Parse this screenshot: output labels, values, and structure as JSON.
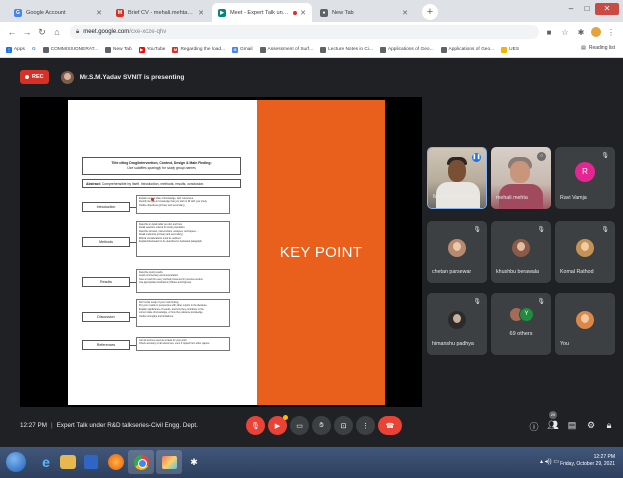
{
  "browser": {
    "tabs": [
      {
        "label": "Google Account",
        "icon": "google-g-icon",
        "active": false
      },
      {
        "label": "Brief CV - mehali.mehta@svnit.ac.in",
        "icon": "gmail-icon",
        "active": false
      },
      {
        "label": "Meet - Expert Talk under R&",
        "icon": "meet-icon",
        "active": true
      },
      {
        "label": "New Tab",
        "icon": "chrome-icon",
        "active": false
      }
    ],
    "address": {
      "host": "meet.google.com",
      "path": "/cxe-xcze-qhv"
    },
    "bookmarks": [
      {
        "label": "Apps",
        "icon": "apps-grid-icon",
        "color": "#1a73e8"
      },
      {
        "label": "G",
        "icon": "google-g-icon",
        "color": "#4285f4"
      },
      {
        "label": "COMMISSIONERAT...",
        "icon": "globe-icon",
        "color": "#5f6368"
      },
      {
        "label": "New Tab",
        "icon": "globe-icon",
        "color": "#5f6368"
      },
      {
        "label": "YouTube",
        "icon": "youtube-icon",
        "color": "#ff0000"
      },
      {
        "label": "Regarding the load...",
        "icon": "gmail-icon",
        "color": "#d93025"
      },
      {
        "label": "Gmail",
        "icon": "google-g-icon",
        "color": "#4285f4"
      },
      {
        "label": "Assessment of Surf...",
        "icon": "globe-icon",
        "color": "#5f6368"
      },
      {
        "label": "Lecture Notes in Ci...",
        "icon": "globe-icon",
        "color": "#5f6368"
      },
      {
        "label": "Applications of Geo...",
        "icon": "globe-icon",
        "color": "#5f6368"
      },
      {
        "label": "Applications of Geo...",
        "icon": "globe-icon",
        "color": "#5f6368"
      },
      {
        "label": "UES",
        "icon": "folder-icon",
        "color": "#f4b400"
      }
    ],
    "reading_list": "Reading list"
  },
  "meet": {
    "rec_label": "REC",
    "presenting": "Mr.S.M.Yadav SVNIT is presenting",
    "time": "12:27 PM",
    "separator": "|",
    "meeting_title": "Expert Talk under R&D talkseries-Civil Engg. Dept.",
    "people_count": "20",
    "participants": [
      {
        "name": "Mr.S.M.Yadav SV..."
      },
      {
        "name": "mehali mehta"
      },
      {
        "name": "Ravi Vamja",
        "initial": "R"
      },
      {
        "name": "chetan parsewar"
      },
      {
        "name": "khushbu berawala"
      },
      {
        "name": "Komal Rathod"
      },
      {
        "name": "himanshu padhya"
      },
      {
        "name": "69 others",
        "initial": "Y"
      },
      {
        "name": "You"
      }
    ]
  },
  "slide": {
    "title_line1": "Title citing Drug/Intervention, Context, Design & Main Finding:",
    "title_line2": "Use subtitles sparingly for study group names",
    "abstract_label": "Abstract:",
    "abstract_text": "Comprehensible by itself. Introduction, methods, results, conclusion.",
    "keypoint": "KEY POINT",
    "sections": [
      {
        "label": "Introduction",
        "lines": [
          "Explain current state of knowledge, with references.",
          "Identify the gap in knowledge that you wish to fill with your study.",
          "Outline objectives (primary and secondary)."
        ]
      },
      {
        "label": "Methods",
        "lines": [
          "Describe in detail what you did, and how.",
          "Detail selection criteria for study population.",
          "Describe all tests, interventions, analyses, techniques....",
          "Detail endpoints (primary and secondary).",
          "Ethical considerations must be outlined.",
          "Explain/show/teach to be described in dedicated paragraph."
        ]
      },
      {
        "label": "Results",
        "lines": [
          "Describe study results.",
          "Avoid commentary and interpretation.",
          "Give a result for every method presented in previous section.",
          "Use appropriate illustrations (Tables and Figures)."
        ]
      },
      {
        "label": "Discussion",
        "lines": [
          "Don't write recap of your main finding.",
          "Put your results in perspective with other reports in the literature.",
          "Explain significance of results, and how they contribute to the",
          "current state of knowledge, or how they advance knowledge.",
          "Outline strengths and limitations."
        ]
      },
      {
        "label": "References",
        "lines": [
          "List all sources used as a basis for your work.",
          "Check accuracy of all references, even if copied from other papers."
        ]
      }
    ]
  },
  "taskbar": {
    "clock_time": "12:27 PM",
    "clock_date": "Friday, October 29, 2021"
  }
}
